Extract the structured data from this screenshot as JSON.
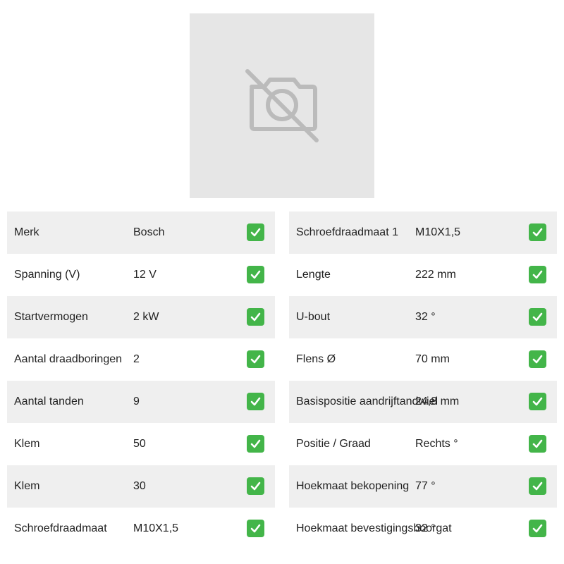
{
  "image": {
    "icon": "camera-off-icon",
    "background": "#e6e6e6",
    "icon_color": "#bbbbbb"
  },
  "specs_left": [
    {
      "label": "Merk",
      "value": "Bosch"
    },
    {
      "label": "Spanning (V)",
      "value": "12 V"
    },
    {
      "label": "Startvermogen",
      "value": "2 kW"
    },
    {
      "label": "Aantal draadboringen",
      "value": "2"
    },
    {
      "label": "Aantal tanden",
      "value": "9"
    },
    {
      "label": "Klem",
      "value": "50"
    },
    {
      "label": "Klem",
      "value": "30"
    },
    {
      "label": "Schroefdraadmaat",
      "value": "M10X1,5"
    }
  ],
  "specs_right": [
    {
      "label": "Schroefdraadmaat 1",
      "value": "M10X1,5"
    },
    {
      "label": "Lengte",
      "value": "222 mm"
    },
    {
      "label": "U-bout",
      "value": "32 °"
    },
    {
      "label": "Flens Ø",
      "value": "70 mm"
    },
    {
      "label": "Basispositie aandrijftandwiel",
      "value": "24,8 mm"
    },
    {
      "label": "Positie / Graad",
      "value": "Rechts °"
    },
    {
      "label": "Hoekmaat bekopening",
      "value": "77 °"
    },
    {
      "label": "Hoekmaat bevestigingsboorgat",
      "value": "32 °"
    }
  ],
  "colors": {
    "row_alt": "#efefef",
    "check": "#43b549"
  }
}
